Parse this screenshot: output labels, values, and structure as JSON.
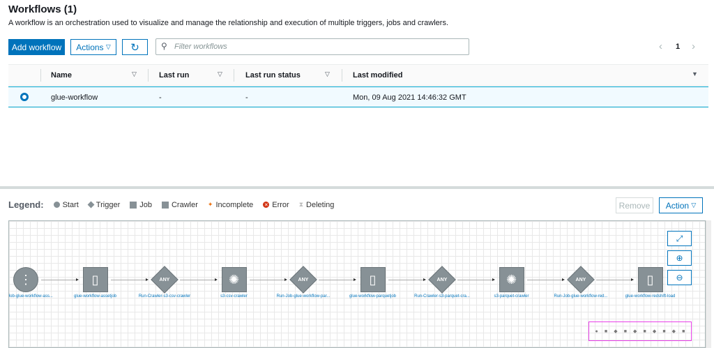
{
  "header": {
    "title": "Workflows (1)",
    "description": "A workflow is an orchestration used to visualize and manage the relationship and execution of multiple triggers, jobs and crawlers."
  },
  "toolbar": {
    "add_label": "Add workflow",
    "actions_label": "Actions",
    "search_placeholder": "Filter workflows",
    "page": "1"
  },
  "table": {
    "columns": [
      "Name",
      "Last run",
      "Last run status",
      "Last modified"
    ],
    "rows": [
      {
        "name": "glue-workflow",
        "last_run": "-",
        "status": "-",
        "modified": "Mon, 09 Aug 2021 14:46:32 GMT"
      }
    ]
  },
  "legend": {
    "title": "Legend:",
    "items": [
      "Start",
      "Trigger",
      "Job",
      "Crawler",
      "Incomplete",
      "Error",
      "Deleting"
    ]
  },
  "graph_toolbar": {
    "remove_label": "Remove",
    "action_label": "Action"
  },
  "nodes": [
    {
      "type": "start",
      "label": "Run-Job-glue-workflow-ass..."
    },
    {
      "type": "job",
      "label": "glue-workflow-assetjob"
    },
    {
      "type": "trigger",
      "label": "Run-Crawler-s3-csv-crawler",
      "text": "ANY"
    },
    {
      "type": "crawler",
      "label": "s3-csv-crawler"
    },
    {
      "type": "trigger",
      "label": "Run-Job-glue-workflow-par...",
      "text": "ANY"
    },
    {
      "type": "job",
      "label": "glue-workflow-parquetjob"
    },
    {
      "type": "trigger",
      "label": "Run-Crawler-s3-parquet-cra...",
      "text": "ANY"
    },
    {
      "type": "crawler",
      "label": "s3-parquet-crawler"
    },
    {
      "type": "trigger",
      "label": "Run-Job-glue-workflow-red...",
      "text": "ANY"
    },
    {
      "type": "job",
      "label": "glue-workflow-redshift-load"
    }
  ]
}
